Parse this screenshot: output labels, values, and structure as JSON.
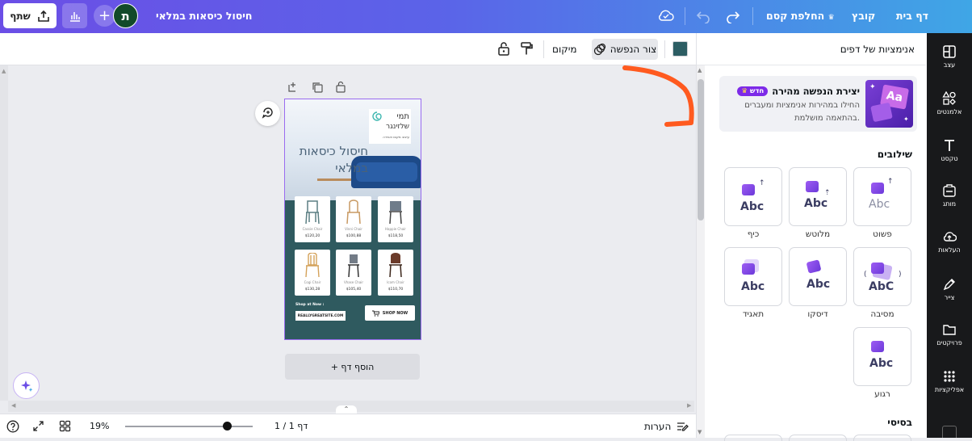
{
  "topbar": {
    "home": "דף בית",
    "file": "קובץ",
    "magic_switch": "החלפת קסם",
    "doc_title": "חיסול כיסאות במלאי",
    "share": "שתף",
    "avatar_letter": "ת"
  },
  "toolbar": {
    "position": "מיקום",
    "animate": "צור הנפשה",
    "swatch_color": "#2c5d63"
  },
  "design": {
    "logo_line1": "תמי",
    "logo_line2": "שלזינגר",
    "logo_line3": "עיצוב מקום ואווירה",
    "headline_line1": "חיסול כיסאות",
    "headline_line2": "במלאי",
    "products": [
      {
        "name": "Cassie Chair",
        "price": "$120,20"
      },
      {
        "name": "Vinni Chair",
        "price": "$100,88"
      },
      {
        "name": "Happie Chair",
        "price": "$118,50"
      },
      {
        "name": "Cogi Chair",
        "price": "$130,28"
      },
      {
        "name": "Vhase Chair",
        "price": "$105,40"
      },
      {
        "name": "Icom Chair",
        "price": "$110,70"
      }
    ],
    "shop_at": "Shop at Now :",
    "site": "REALLYGREATSITE.COM",
    "shop_now": "SHOP NOW"
  },
  "canvas": {
    "add_page": "+ הוסף דף"
  },
  "bottombar": {
    "notes": "הערות",
    "page_indicator": "דף 1 / 1",
    "zoom": "19%",
    "zoom_fraction": 0.8
  },
  "panel": {
    "title": "אנימציות של דפים",
    "promo_title": "יצירת הנפשה מהירה",
    "promo_badge": "חדש",
    "promo_text_line1": "החילו במהירות אנימציות ומעברים",
    "promo_text_line2": "בהתאמה מושלמת.",
    "combos_heading": "שילובים",
    "combos": [
      "פשוט",
      "מלוטש",
      "כיף",
      "מסיבה",
      "דיסקו",
      "תאגיד",
      "רגוע"
    ],
    "abc_text": "Abc",
    "abc_text_alt": "AbC",
    "basic_heading": "בסיסי"
  },
  "rail": {
    "items": [
      "עצב",
      "אלמנטים",
      "טקסט",
      "מותג",
      "העלאות",
      "צייר",
      "פרויקטים",
      "אפליקציות"
    ]
  }
}
